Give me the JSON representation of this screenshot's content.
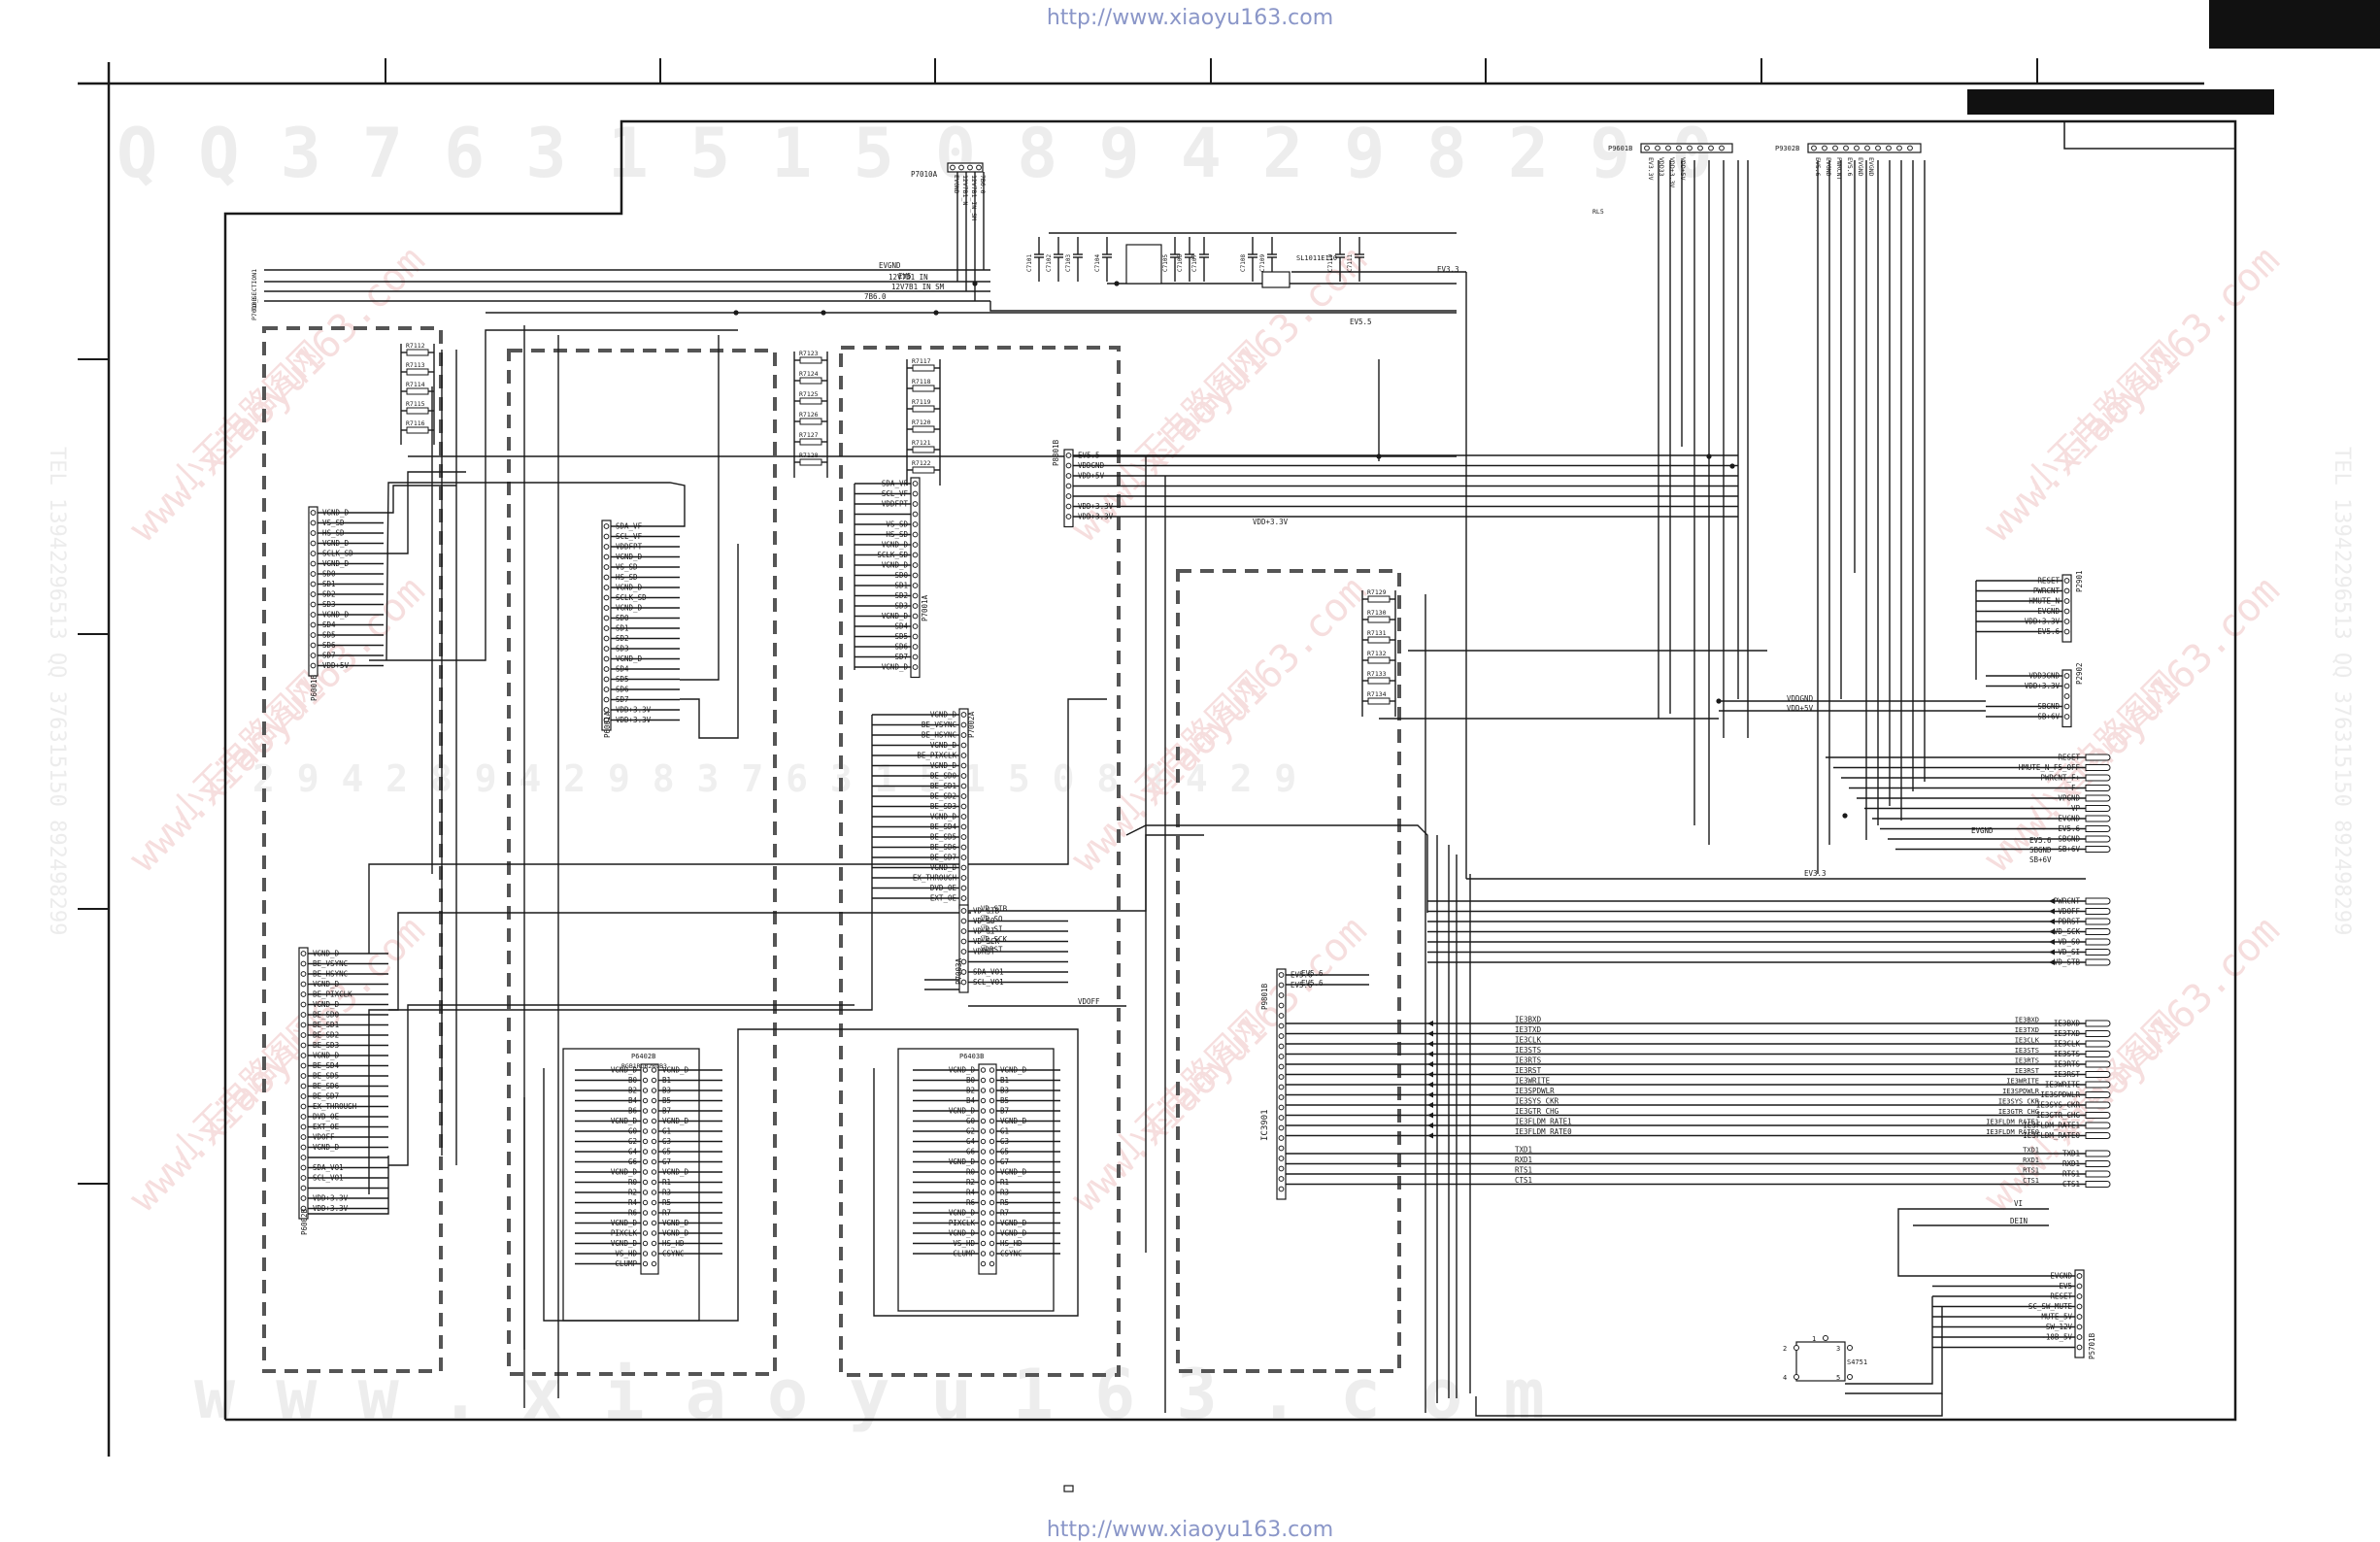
{
  "header": {
    "url_top": "http://www.xiaoyu163.com",
    "url_bottom": "http://www.xiaoyu163.com"
  },
  "watermark": {
    "serial_top": "Q Q 3 7 6 3 1 5 1 5 0    8 9 4 2 9 8 2 9 0",
    "serial_mid": "2 9 4 2 8 9 4 2 9 8    3 7 6 3 1 5 1 5 0    8 9 4 2 9",
    "serial_bottom": "w w w . x i a o y u 1 6 3 . c o m",
    "site": "www.xiaoyu163.com",
    "brand": "小玉电路图网",
    "phone_left": "TEL 13942296513  QQ 376315150  892498299",
    "phone_right": "TEL 13942296513  QQ 376315150  892498299"
  },
  "connectors": {
    "p7010a": {
      "ref": "P7010A",
      "pins": [
        "EVGND",
        "12V7B1_N",
        "12V7B1_IN_SM",
        "7B6.0"
      ]
    },
    "p7010b": {
      "ref": "P7010B",
      "pins": [
        "TO_SECTION1"
      ]
    },
    "p9601b": {
      "ref": "P9601B",
      "pins": [
        "EV3.3V",
        "VDD33",
        "VDD+3.3V",
        "VDD+5V"
      ]
    },
    "p9302b": {
      "ref": "P9302B",
      "pins": [
        "EV5.6",
        "EVGND",
        "PWRCNT",
        "EV5.6",
        "EVGND",
        "EVGND"
      ]
    },
    "p8301b": {
      "ref": "P8301B",
      "pins": [
        "EV5.5",
        "VDDGND",
        "VDD+5V",
        "",
        "",
        "VDD+3.3V",
        "VDD+3.3V"
      ]
    },
    "p6001b": {
      "ref": "P6001B",
      "pins": [
        "VGND_D",
        "VS_SD",
        "HS_SD",
        "VGND_D",
        "SCLK_SD",
        "VGND_D",
        "SD0",
        "SD1",
        "SD2",
        "SD3",
        "VGND_D",
        "SD4",
        "SD5",
        "SD6",
        "SD7",
        "VDD+5V"
      ]
    },
    "p6001a": {
      "ref": "P6001A",
      "pins": [
        "SDA_VF",
        "SCL_VF",
        "VDDFPT",
        "VGND_D",
        "VS_SD",
        "HS_SD",
        "VGND_D",
        "SCLK_SD",
        "VGND_D",
        "SD0",
        "SD1",
        "SD2",
        "SD3",
        "VGND_D",
        "SD4",
        "SD5",
        "SD6",
        "SD7",
        "VDD+3.3V",
        "VDD+3.3V"
      ]
    },
    "p7001a": {
      "ref": "P7001A",
      "pins": [
        "SDA_VF",
        "SCL_VF",
        "VDDFPT",
        "",
        "VS_SD",
        "HS_SD",
        "VGND_D",
        "SCLK_SD",
        "VGND_D",
        "SD0",
        "SD1",
        "SD2",
        "SD3",
        "VGND_D",
        "SD4",
        "SD5",
        "SD6",
        "SD7",
        "VGND_D"
      ]
    },
    "p7002a": {
      "ref": "P7002A",
      "pins": [
        "VGND_D",
        "BE_VSYNC",
        "BE_HSYNC",
        "VGND_D",
        "BE_PIXCLK",
        "VGND_D",
        "BE_SD0",
        "BE_SD1",
        "BE_SD2",
        "BE_SD3",
        "VGND_D",
        "BE_SD4",
        "BE_SD5",
        "BE_SD6",
        "BE_SD7",
        "VGND_D",
        "EX_THROUGH",
        "DVD_OE",
        "EXT_OE"
      ]
    },
    "p7003a": {
      "ref": "P7003A",
      "pins": [
        "VD_STB",
        "VD_SO",
        "VD_SI",
        "VD_SCK",
        "VDRST",
        "",
        "SDA_VO1",
        "SCL_VO1"
      ]
    },
    "p6002b": {
      "ref": "P6002B",
      "pins": [
        "VGND_D",
        "BE_VSYNC",
        "BE_HSYNC",
        "VGND_D",
        "BE_PIXCLK",
        "VGND_D",
        "BE_SD0",
        "BE_SD1",
        "BE_SD2",
        "BE_SD3",
        "VGND_D",
        "BE_SD4",
        "BE_SD5",
        "BE_SD6",
        "BE_SD7",
        "EX_THROUGH",
        "DVD_OE",
        "EXT_OE",
        "VDOFF",
        "VGND_D",
        "",
        "SDA_VO1",
        "SCL_VO1",
        "",
        "VDD+3.3V",
        "VDD+3.3V"
      ]
    },
    "p9801b": {
      "ref": "P9801B",
      "pins": [
        "EV5.6",
        "EV5.6",
        "",
        "",
        "",
        "",
        "",
        "",
        "",
        "",
        "",
        "",
        "",
        "",
        "",
        "",
        "",
        "",
        "",
        "",
        "",
        ""
      ]
    },
    "p5301b": {
      "ref": "P5301B",
      "pins": [
        "EV5.6",
        "EV5.6"
      ]
    },
    "p6402b": {
      "ref": "P6402B",
      "top_label": "RGB1RGB2RGB3",
      "left": [
        "VGND_D",
        "B0",
        "B2",
        "B4",
        "B6",
        "VGND_D",
        "G0",
        "G2",
        "G4",
        "G6",
        "VGND_D",
        "R0",
        "R2",
        "R4",
        "R6",
        "VGND_D",
        "PIXCLK",
        "VGND_D",
        "VS_HD",
        "CLUMP"
      ],
      "right": [
        "VGND_D",
        "B1",
        "B3",
        "B5",
        "B7",
        "VGND_D",
        "G1",
        "G3",
        "G5",
        "G7",
        "VGND_D",
        "R1",
        "R3",
        "R5",
        "R7",
        "VGND_D",
        "VGND_D",
        "HS_HD",
        "CSYNC",
        ""
      ]
    },
    "p6403b": {
      "ref": "P6403B",
      "left": [
        "VGND_D",
        "B0",
        "B2",
        "B4",
        "VGND_D",
        "G0",
        "G2",
        "G4",
        "G6",
        "VGND_D",
        "R0",
        "R2",
        "R4",
        "R6",
        "VGND_D",
        "PIXCLK",
        "VGND_D",
        "VS_HD",
        "CLUMP"
      ],
      "right": [
        "VGND_D",
        "B1",
        "B3",
        "B5",
        "B7",
        "VGND_D",
        "G1",
        "G3",
        "G5",
        "G7",
        "VGND_D",
        "R1",
        "R3",
        "R5",
        "R7",
        "VGND_D",
        "VGND_D",
        "HS_HD",
        "CSYNC",
        ""
      ]
    },
    "p2901": {
      "ref": "P2901",
      "pins": [
        "RESET",
        "PWRCNT",
        "HMUTE_N",
        "EVGND",
        "VDD+3.3V",
        "EV5.6"
      ]
    },
    "p2902": {
      "ref": "P2902",
      "pins": [
        "VDD3GND",
        "VDD+3.3V",
        "",
        "SBGND",
        "SB+6V"
      ]
    },
    "p5701b": {
      "ref": "P5701B",
      "pins": [
        "EVGND",
        "EV5",
        "RESET",
        "SC_SW_MUTE",
        "MUTE_5V",
        "SW_12V",
        "-18B_5V",
        ""
      ]
    }
  },
  "labels": {
    "ic_main": "IC3901",
    "switch": "S4751",
    "sl_part": "SL1011E110",
    "rl5": "RL5",
    "ev33": "EV3.3",
    "ev55": "EV5.5",
    "vdd33": "VDD+3.3V",
    "vdoff": "VDOFF",
    "evgnd_top": "EVGND",
    "ev5_top": "EV5",
    "n12v": "12V7B1_IN",
    "n12vsm": "12V7B1_IN_SM",
    "n7b6": "7B6.0",
    "vddgnd_r": "VDDGND",
    "vdd5_r": "VDD+5V",
    "evgnd_r": "EVGND",
    "ev56_r": "EV5.6",
    "sbgnd_r": "SBGND",
    "sb6v_r": "SB+6V",
    "ev33_r": "EV3.3",
    "r_lbl_a": "2",
    "r_lbl_b": "4",
    "r_lbl_c": "1",
    "r_lbl_d": "3",
    "r_lbl_e": "5",
    "vi_lbl": "VI",
    "dein_lbl": "DEIN"
  },
  "resistors": {
    "col1": [
      "R7112",
      "R7113",
      "R7114",
      "R7115",
      "R7116"
    ],
    "col2": [
      "R7123",
      "R7124",
      "R7125",
      "R7126",
      "R7127",
      "R7128"
    ],
    "col3": [
      "R7117",
      "R7118",
      "R7119",
      "R7120",
      "R7121",
      "R7122"
    ],
    "col4": [
      "R7129",
      "R7130",
      "R7131",
      "R7132",
      "R7133",
      "R7134"
    ]
  },
  "right_signals_a": [
    "RESET",
    "HMUTE_N_F5_OFF",
    "PWRCNT_F+",
    "F-",
    "-VPGND",
    "-VP",
    "EVGND",
    "EV5.6",
    "SBGND",
    "SB+6V"
  ],
  "right_signals_b": [
    "PWRCNT",
    "VDOFF",
    "PDRST",
    "VD_SCK",
    "VD_SO",
    "VD_SI",
    "VD_STB"
  ],
  "right_signals_c": [
    "IE3BXD",
    "IE3TXD",
    "IE3CLK",
    "IE3STS",
    "IE3RTS",
    "IE3RST",
    "IE3WRITE",
    "IE3SPDWLR",
    "IE3SYS_CKR",
    "IE3GTR_CHG",
    "IE3FLDM_RATE1",
    "IE3FLDM_RATE0"
  ],
  "right_signals_d": [
    "TXD1",
    "RXD1",
    "RTS1",
    "CTS1"
  ],
  "mid_signals_c": [
    "IE3BXD",
    "IE3TXD",
    "IE3CLK",
    "IE3STS",
    "IE3RTS",
    "IE3RST",
    "IE3WRITE",
    "IE3SPDWLR",
    "IE3SYS_CKR",
    "IE3GTR_CHG",
    "IE3FLDM_RATE1",
    "IE3FLDM_RATE0"
  ],
  "mid_signals_d": [
    "TXD1",
    "RXD1",
    "RTS1",
    "CTS1"
  ],
  "mid_signals_b": [
    "VD_STB",
    "VD_SO",
    "VD_SI",
    "VD_SCK",
    "VDRST"
  ],
  "cap_labels": [
    "C7101",
    "C7102",
    "C7103",
    "C7104",
    "C7105",
    "C7106",
    "C7107",
    "C7108",
    "C7109",
    "C7110",
    "C7111"
  ],
  "colors": {
    "line": "#1a1a1a",
    "dash": "#555555",
    "wm": "#ececec",
    "wm_red": "#f3d2d2",
    "url": "#8a96c8"
  }
}
